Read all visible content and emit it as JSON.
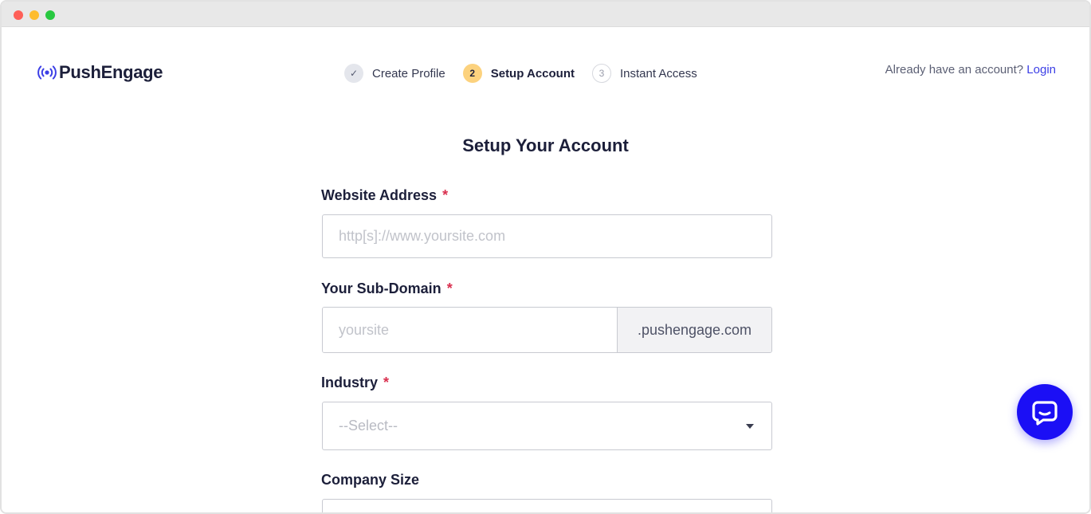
{
  "brand": {
    "name": "PushEngage",
    "accent": "#3c3fe6",
    "chat_color": "#1b0ff5"
  },
  "steps": [
    {
      "number": "✓",
      "label": "Create Profile",
      "state": "done"
    },
    {
      "number": "2",
      "label": "Setup Account",
      "state": "active"
    },
    {
      "number": "3",
      "label": "Instant Access",
      "state": "pending"
    }
  ],
  "auth": {
    "prompt": "Already have an account? ",
    "login_label": "Login"
  },
  "form": {
    "title": "Setup Your Account",
    "required_mark": "*",
    "website": {
      "label": "Website Address",
      "placeholder": "http[s]://www.yoursite.com",
      "value": ""
    },
    "subdomain": {
      "label": "Your Sub-Domain",
      "placeholder": "yoursite",
      "suffix": ".pushengage.com",
      "value": ""
    },
    "industry": {
      "label": "Industry",
      "selected": "--Select--"
    },
    "company_size": {
      "label": "Company Size"
    }
  },
  "icons": {
    "logo": "broadcast-icon",
    "chat": "chat-bubble-icon",
    "caret": "caret-down-icon"
  }
}
